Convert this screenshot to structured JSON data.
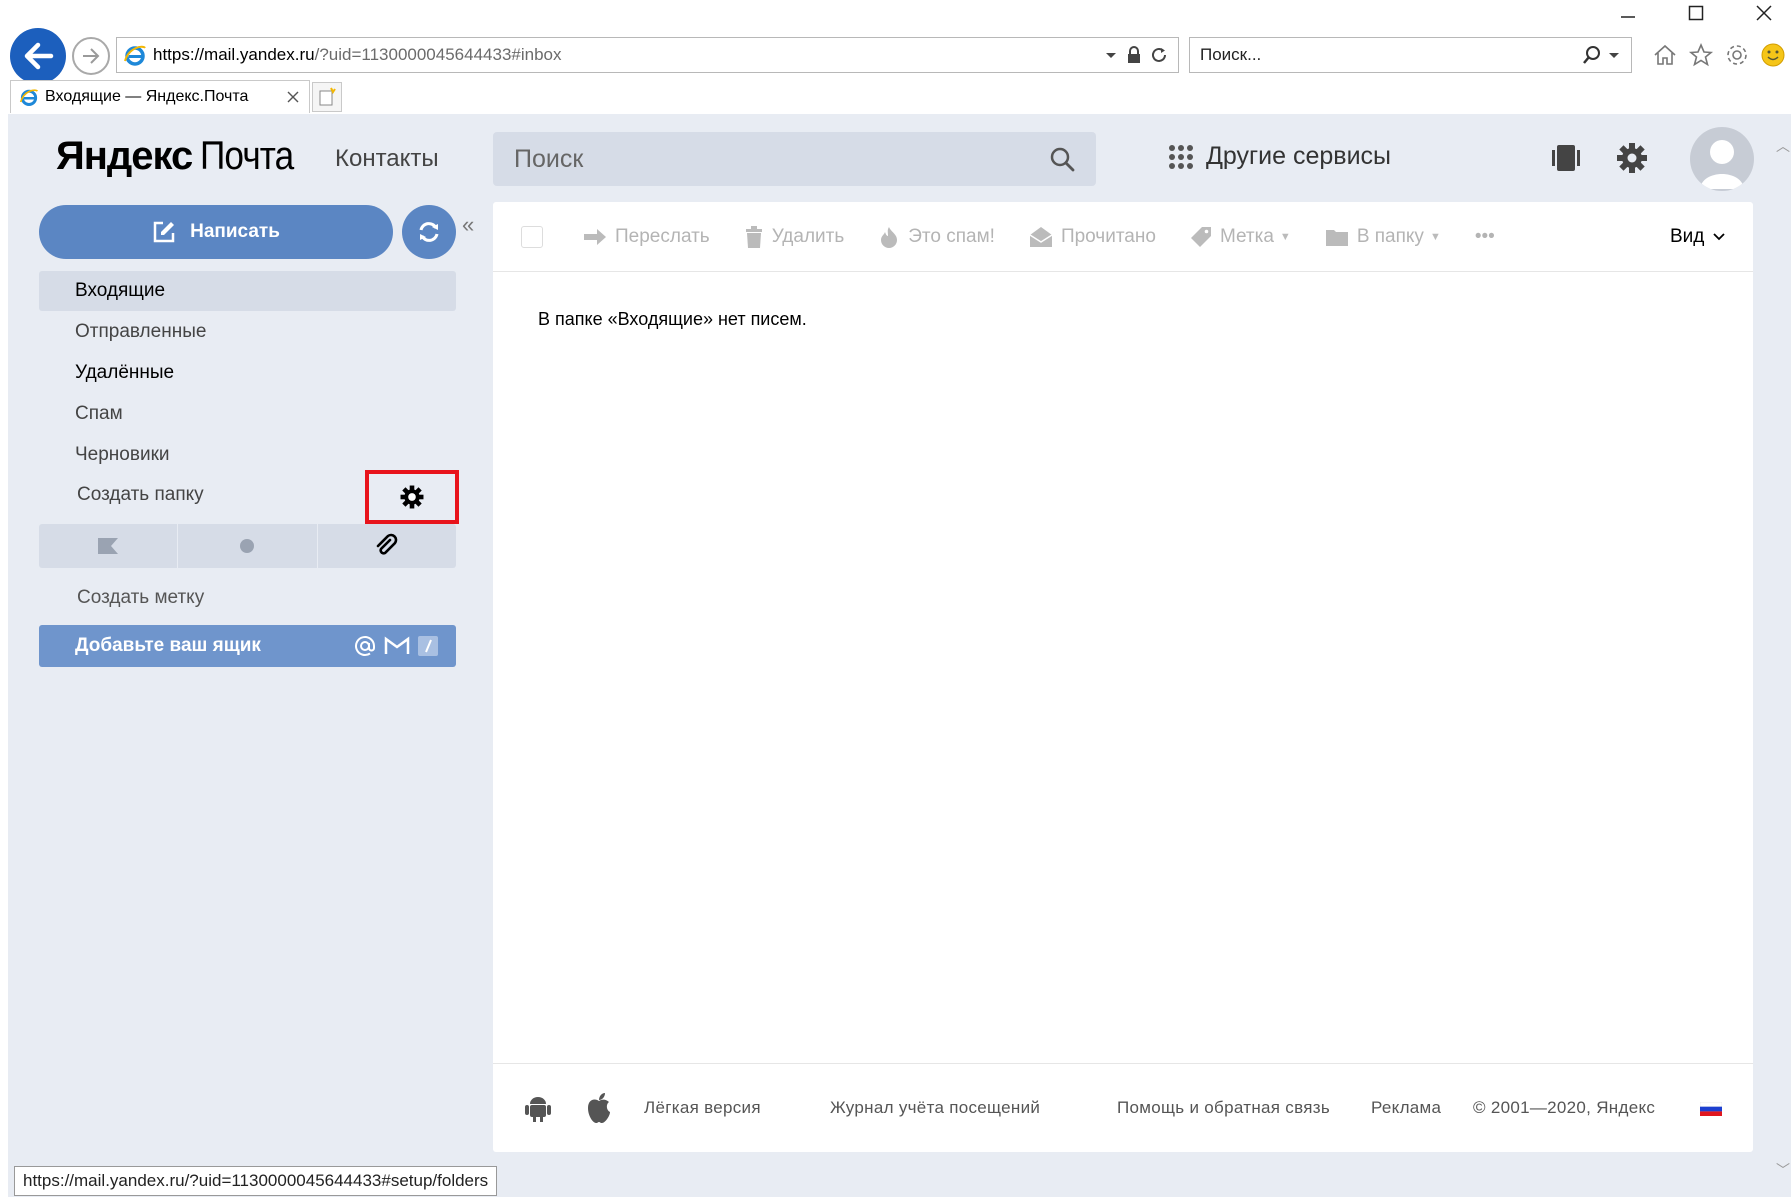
{
  "browser": {
    "url_prefix": "https://",
    "url_domain": "mail.yandex.ru",
    "url_rest": "/?uid=1130000045644433#inbox",
    "search_placeholder": "Поиск...",
    "tab_title": "Входящие — Яндекс.Почта",
    "status_url": "https://mail.yandex.ru/?uid=1130000045644433#setup/folders"
  },
  "header": {
    "logo_yandex": "Яндекс",
    "logo_pochta": "Почта",
    "contacts": "Контакты",
    "search_placeholder": "Поиск",
    "other_services": "Другие сервисы"
  },
  "sidebar": {
    "compose": "Написать",
    "folders": [
      {
        "label": "Входящие"
      },
      {
        "label": "Отправленные"
      },
      {
        "label": "Удалённые"
      },
      {
        "label": "Спам"
      },
      {
        "label": "Черновики"
      }
    ],
    "create_folder": "Создать папку",
    "create_label": "Создать метку",
    "add_mailbox": "Добавьте ваш ящик"
  },
  "toolbar": {
    "forward": "Переслать",
    "delete": "Удалить",
    "spam": "Это спам!",
    "read": "Прочитано",
    "label": "Метка",
    "to_folder": "В папку",
    "more": "•••",
    "view": "Вид"
  },
  "main": {
    "empty_message": "В папке «Входящие» нет писем."
  },
  "footer": {
    "light_version": "Лёгкая версия",
    "visit_log": "Журнал учёта посещений",
    "help": "Помощь и обратная связь",
    "ads": "Реклама",
    "copyright": "© 2001—2020, Яндекс"
  },
  "colors": {
    "accent": "#5b86c3",
    "highlight_box": "#e8141c",
    "page_bg": "#e8ecf3"
  }
}
